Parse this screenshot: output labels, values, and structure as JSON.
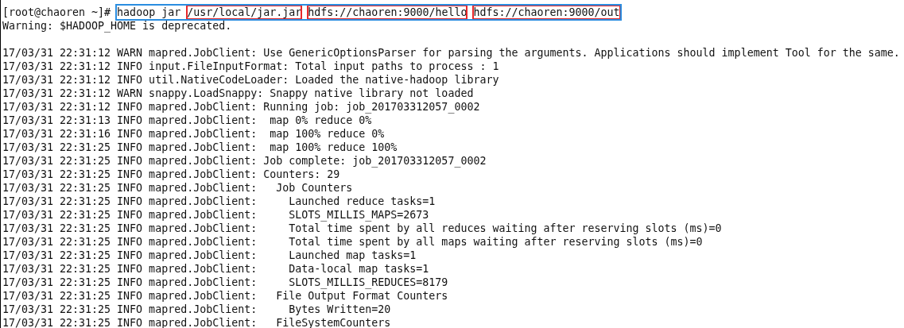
{
  "terminal": {
    "prompt": "[root@chaoren ~]#",
    "command": {
      "outlined": true,
      "segments": [
        {
          "text": "hadoop jar",
          "boxed": false
        },
        {
          "text": "/usr/local/jar.jar",
          "boxed": true
        },
        {
          "text": "hdfs://chaoren:9000/hello",
          "boxed": true
        },
        {
          "text": "hdfs://chaoren:9000/out",
          "boxed": true
        }
      ]
    },
    "lines": [
      "Warning: $HADOOP_HOME is deprecated.",
      {
        "kind": "blank"
      },
      "17/03/31 22:31:12 WARN mapred.JobClient: Use GenericOptionsParser for parsing the arguments. Applications should implement Tool for the same.",
      "17/03/31 22:31:12 INFO input.FileInputFormat: Total input paths to process : 1",
      "17/03/31 22:31:12 INFO util.NativeCodeLoader: Loaded the native-hadoop library",
      "17/03/31 22:31:12 WARN snappy.LoadSnappy: Snappy native library not loaded",
      "17/03/31 22:31:12 INFO mapred.JobClient: Running job: job_201703312057_0002",
      "17/03/31 22:31:13 INFO mapred.JobClient:  map 0% reduce 0%",
      "17/03/31 22:31:16 INFO mapred.JobClient:  map 100% reduce 0%",
      "17/03/31 22:31:25 INFO mapred.JobClient:  map 100% reduce 100%",
      "17/03/31 22:31:25 INFO mapred.JobClient: Job complete: job_201703312057_0002",
      "17/03/31 22:31:25 INFO mapred.JobClient: Counters: 29",
      "17/03/31 22:31:25 INFO mapred.JobClient:   Job Counters",
      "17/03/31 22:31:25 INFO mapred.JobClient:     Launched reduce tasks=1",
      "17/03/31 22:31:25 INFO mapred.JobClient:     SLOTS_MILLIS_MAPS=2673",
      "17/03/31 22:31:25 INFO mapred.JobClient:     Total time spent by all reduces waiting after reserving slots (ms)=0",
      "17/03/31 22:31:25 INFO mapred.JobClient:     Total time spent by all maps waiting after reserving slots (ms)=0",
      "17/03/31 22:31:25 INFO mapred.JobClient:     Launched map tasks=1",
      "17/03/31 22:31:25 INFO mapred.JobClient:     Data-local map tasks=1",
      "17/03/31 22:31:25 INFO mapred.JobClient:     SLOTS_MILLIS_REDUCES=8179",
      "17/03/31 22:31:25 INFO mapred.JobClient:   File Output Format Counters",
      "17/03/31 22:31:25 INFO mapred.JobClient:     Bytes Written=20",
      "17/03/31 22:31:25 INFO mapred.JobClient:   FileSystemCounters"
    ]
  }
}
